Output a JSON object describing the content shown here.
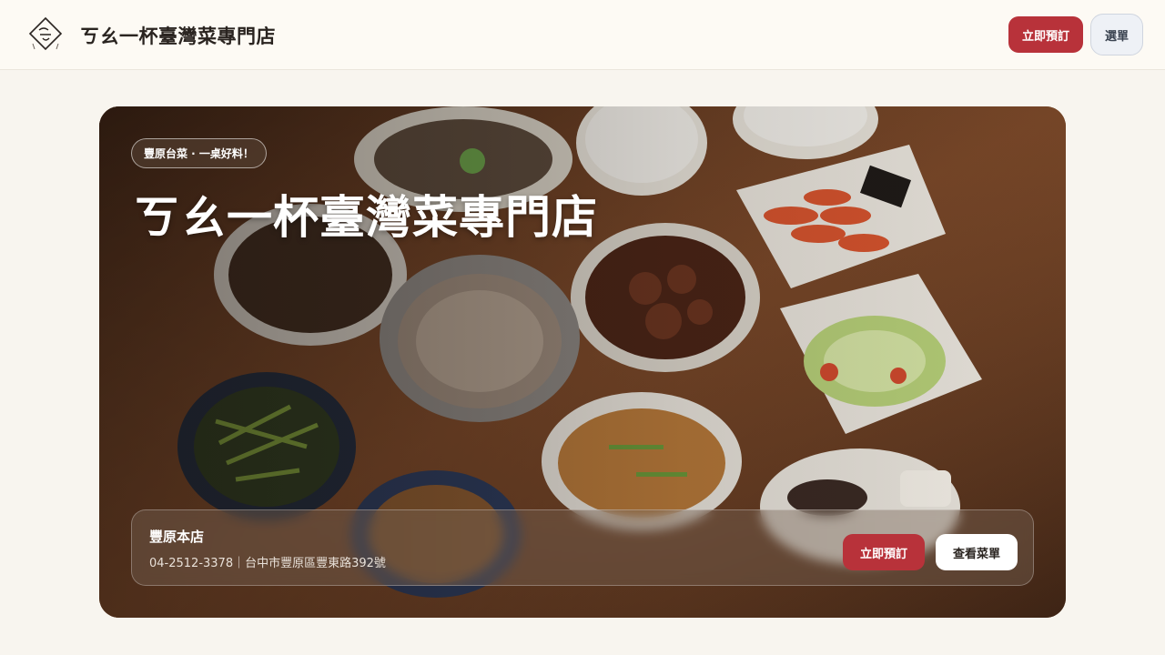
{
  "header": {
    "logo_alt": "logo",
    "brand_name": "ㄎㄠ一杯臺灣菜專門店",
    "reserve_button": "立即預訂",
    "menu_button": "選單"
  },
  "hero": {
    "tagline": "豐原台菜 · 一桌好料！",
    "title": "ㄎㄠ一杯臺灣菜專門店",
    "branch": {
      "name": "豐原本店",
      "contact": "04-2512-3378｜台中市豐原區豐東路392號",
      "reserve_button": "立即預訂",
      "view_menu_button": "查看菜單"
    }
  },
  "colors": {
    "accent_red": "#b8323a",
    "header_bg": "#fdfaf4",
    "page_bg": "#f8f5ef"
  }
}
